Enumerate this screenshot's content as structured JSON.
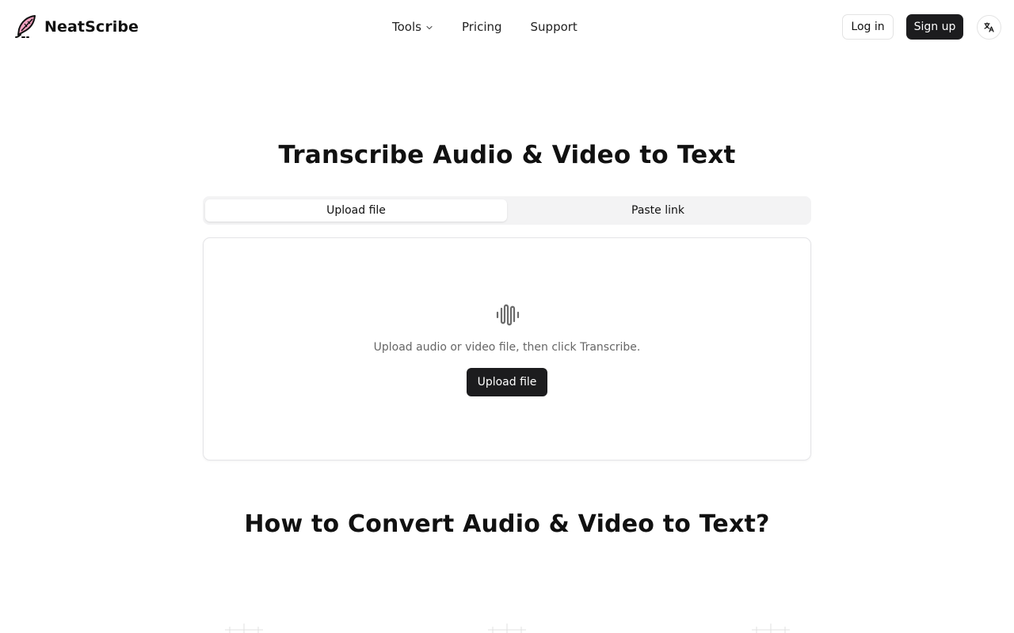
{
  "brand": {
    "name": "NeatScribe",
    "logo_icon": "quill-icon",
    "accent": "#f2a1c0"
  },
  "nav": {
    "items": [
      {
        "label": "Tools",
        "has_dropdown": true
      },
      {
        "label": "Pricing"
      },
      {
        "label": "Support"
      }
    ]
  },
  "header_actions": {
    "login_label": "Log in",
    "signup_label": "Sign up",
    "language_icon": "translate-icon"
  },
  "hero": {
    "title": "Transcribe Audio & Video to Text",
    "tabs": [
      {
        "label": "Upload file",
        "active": true
      },
      {
        "label": "Paste link",
        "active": false
      }
    ],
    "upload": {
      "icon": "audio-wave-icon",
      "hint": "Upload audio or video file, then click Transcribe.",
      "button_label": "Upload file"
    }
  },
  "how_to": {
    "title": "How to Convert Audio & Video to Text?"
  },
  "colors": {
    "primary_button": "#1c1c1e",
    "tab_bg": "#f3f3f4",
    "border": "#e4e4e7",
    "muted_text": "#666666"
  }
}
